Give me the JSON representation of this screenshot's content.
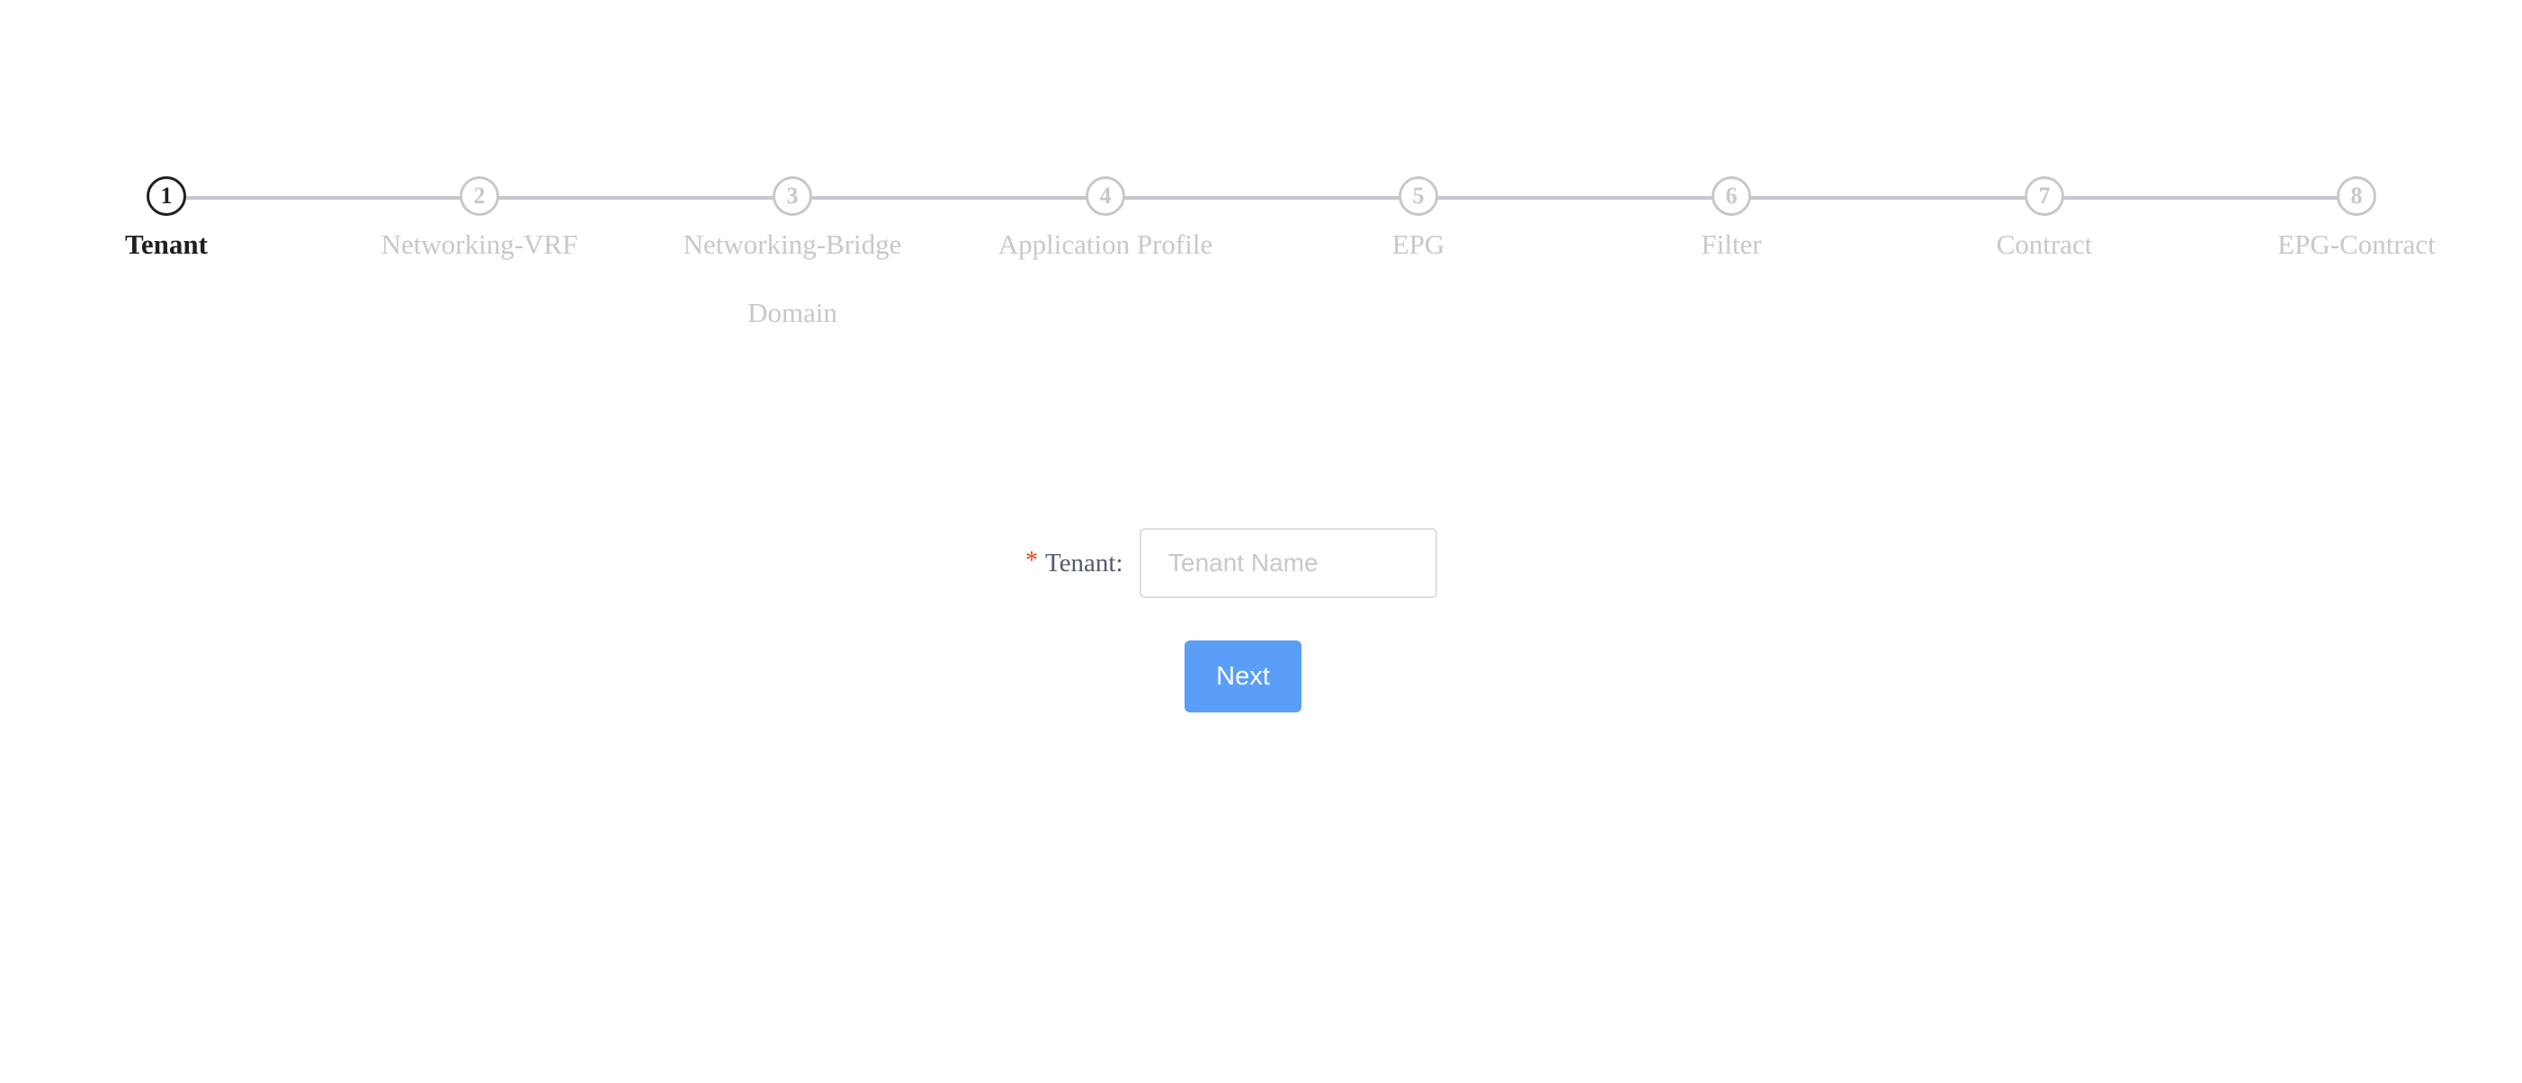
{
  "wizard": {
    "current_step": 1,
    "steps": [
      {
        "number": "1",
        "label": "Tenant",
        "label_line2": ""
      },
      {
        "number": "2",
        "label": "Networking-VRF",
        "label_line2": ""
      },
      {
        "number": "3",
        "label": "Networking-Bridge",
        "label_line2": "Domain"
      },
      {
        "number": "4",
        "label": "Application Profile",
        "label_line2": ""
      },
      {
        "number": "5",
        "label": "EPG",
        "label_line2": ""
      },
      {
        "number": "6",
        "label": "Filter",
        "label_line2": ""
      },
      {
        "number": "7",
        "label": "Contract",
        "label_line2": ""
      },
      {
        "number": "8",
        "label": "EPG-Contract",
        "label_line2": ""
      }
    ]
  },
  "form": {
    "required_marker": "*",
    "tenant_label": "Tenant:",
    "tenant_value": "",
    "tenant_placeholder": "Tenant Name",
    "next_label": "Next"
  },
  "colors": {
    "primary": "#5a9ef8",
    "active_step": "#1f1f1f",
    "inactive_step": "#c5c8ce",
    "required": "#ed4014"
  }
}
